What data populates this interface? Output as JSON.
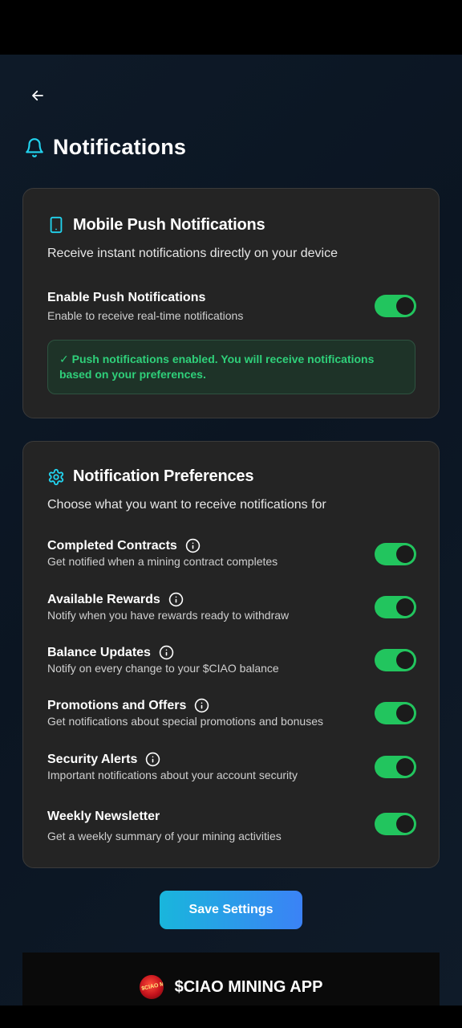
{
  "colors": {
    "accent": "#22d3ee",
    "toggle_on": "#22c55e",
    "success_text": "#2fd07a",
    "button_from": "#19b6dc",
    "button_to": "#3b82f6"
  },
  "header": {
    "title": "Notifications",
    "icon": "bell-icon",
    "back_icon": "arrow-left-icon"
  },
  "push": {
    "title": "Mobile Push Notifications",
    "icon": "smartphone-icon",
    "subtitle": "Receive instant notifications directly on your device",
    "enable": {
      "label": "Enable Push Notifications",
      "description": "Enable to receive real-time notifications",
      "on": true
    },
    "status_message": "✓ Push notifications enabled. You will receive notifications based on your preferences."
  },
  "preferences": {
    "title": "Notification Preferences",
    "icon": "gear-icon",
    "subtitle": "Choose what you want to receive notifications for",
    "items": [
      {
        "label": "Completed Contracts",
        "description": "Get notified when a mining contract completes",
        "on": true,
        "info": true
      },
      {
        "label": "Available Rewards",
        "description": "Notify when you have rewards ready to withdraw",
        "on": true,
        "info": true
      },
      {
        "label": "Balance Updates",
        "description": "Notify on every change to your $CIAO balance",
        "on": true,
        "info": true
      },
      {
        "label": "Promotions and Offers",
        "description": "Get notifications about special promotions and bonuses",
        "on": true,
        "info": true
      },
      {
        "label": "Security Alerts",
        "description": "Important notifications about your account security",
        "on": true,
        "info": true
      },
      {
        "label": "Weekly Newsletter",
        "description": "Get a weekly summary of your mining activities",
        "on": true,
        "info": false
      }
    ]
  },
  "save_button": "Save Settings",
  "footer": {
    "brand": "$CIAO MINING APP",
    "logo_text": "$CIAO MINING"
  }
}
